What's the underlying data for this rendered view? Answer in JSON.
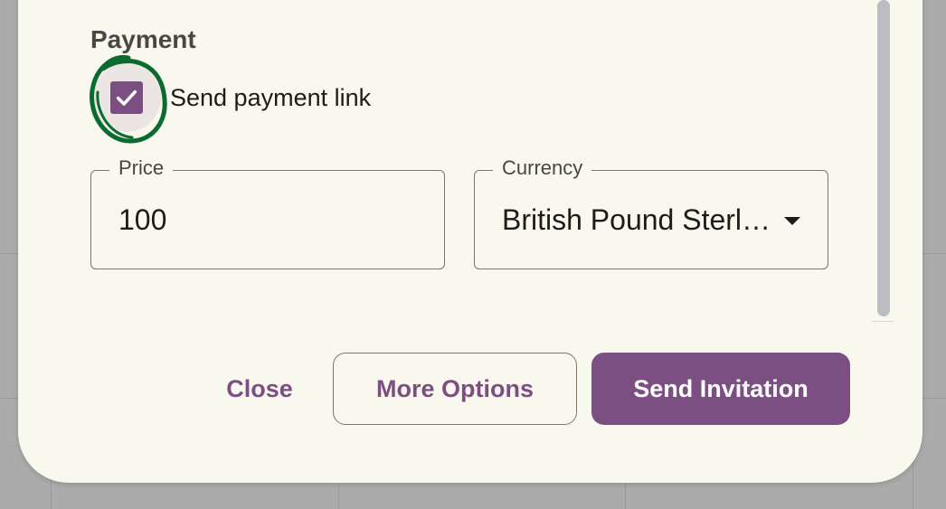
{
  "payment": {
    "title": "Payment",
    "send_link_label": "Send payment link",
    "send_link_checked": true
  },
  "price": {
    "label": "Price",
    "value": "100"
  },
  "currency": {
    "label": "Currency",
    "value": "British Pound Sterling",
    "icon": "dropdown-arrow-icon"
  },
  "actions": {
    "close": "Close",
    "more_options": "More Options",
    "send_invitation": "Send Invitation"
  },
  "colors": {
    "primary": "#7b4f82",
    "surface": "#f8f8ee",
    "backdrop": "#ababab",
    "annotation": "#0b6b2e"
  }
}
